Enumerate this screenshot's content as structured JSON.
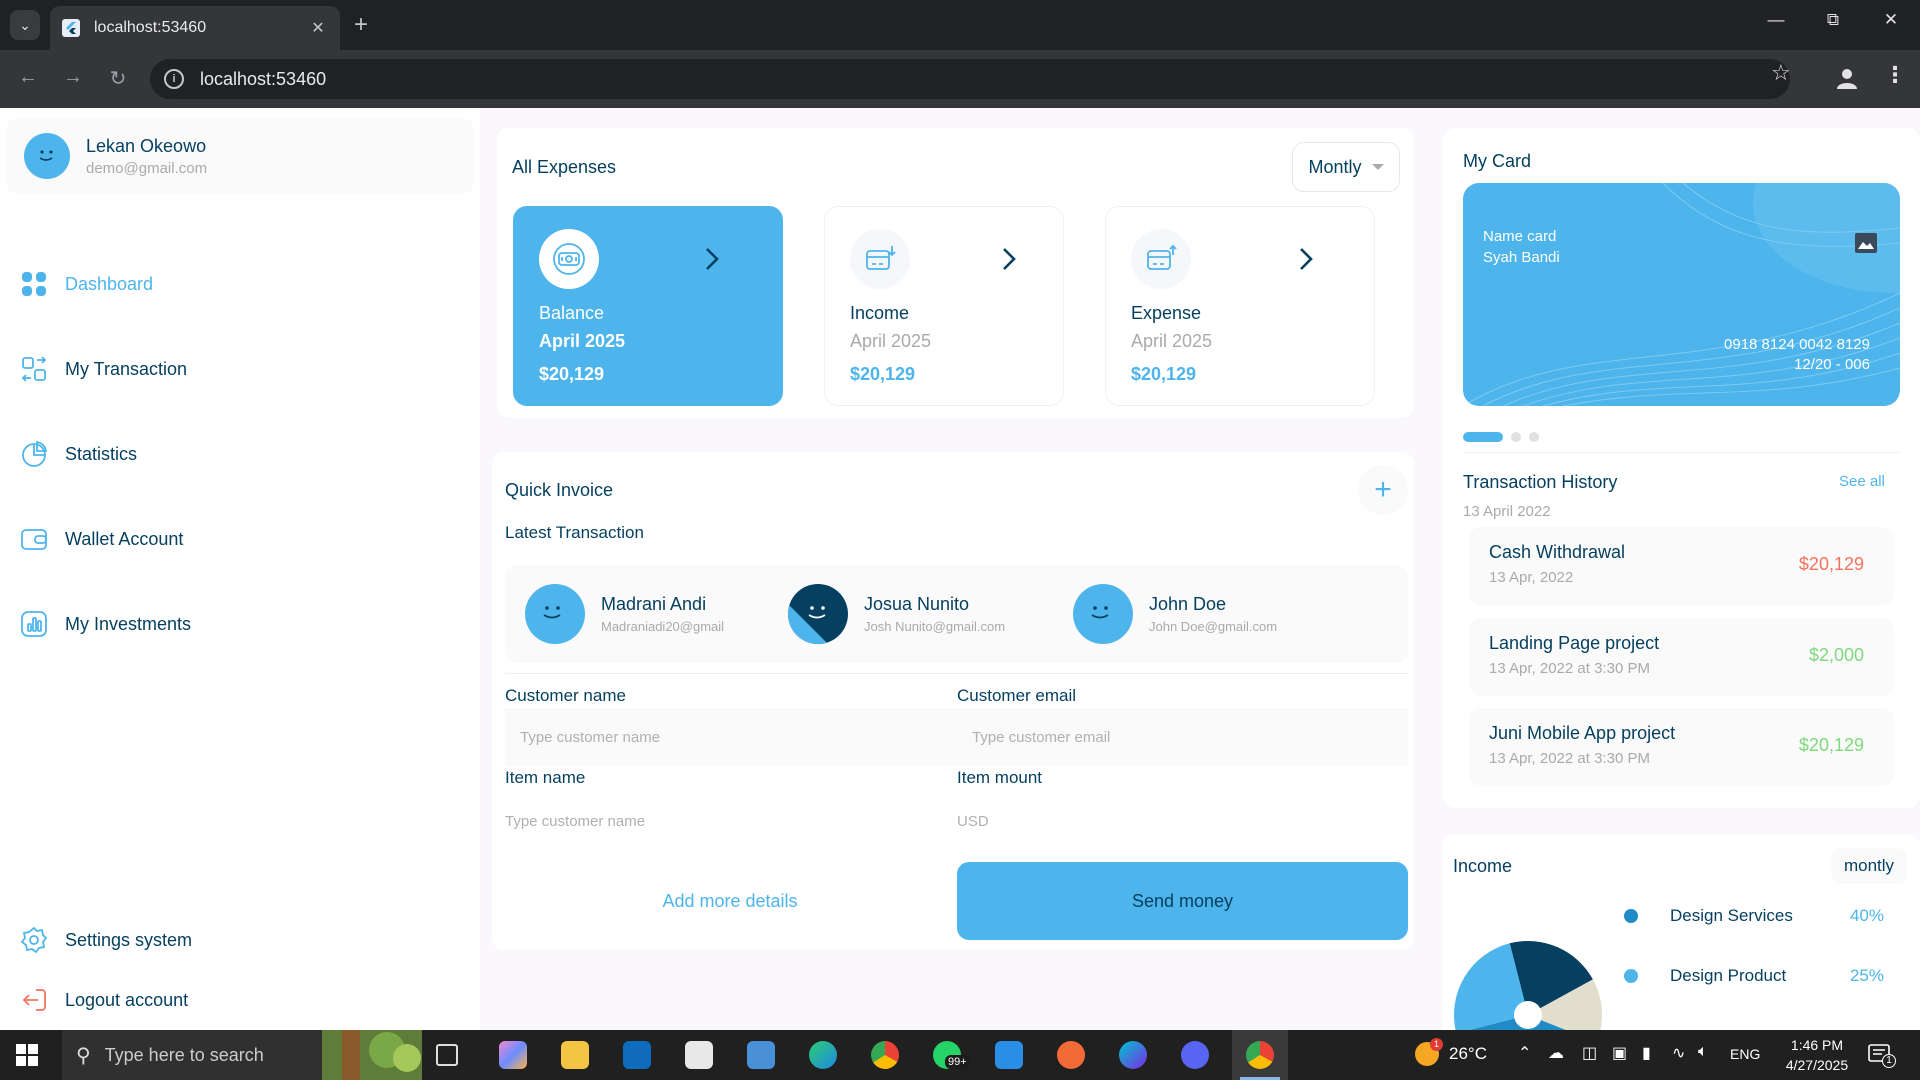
{
  "browser": {
    "tab_title": "localhost:53460",
    "url": "localhost:53460"
  },
  "user": {
    "name": "Lekan Okeowo",
    "email": "demo@gmail.com"
  },
  "sidebar": {
    "items": [
      {
        "label": "Dashboard",
        "icon": "dashboard-icon",
        "active": true
      },
      {
        "label": "My Transaction",
        "icon": "transaction-icon"
      },
      {
        "label": "Statistics",
        "icon": "statistics-icon"
      },
      {
        "label": "Wallet Account",
        "icon": "wallet-icon"
      },
      {
        "label": "My Investments",
        "icon": "investments-icon"
      }
    ],
    "bottom": [
      {
        "label": "Settings system",
        "icon": "settings-icon"
      },
      {
        "label": "Logout account",
        "icon": "logout-icon"
      }
    ]
  },
  "expenses": {
    "title": "All Expenses",
    "period": "Montly",
    "cards": [
      {
        "name": "Balance",
        "date": "April 2025",
        "amount": "$20,129",
        "active": true
      },
      {
        "name": "Income",
        "date": "April 2025",
        "amount": "$20,129"
      },
      {
        "name": "Expense",
        "date": "April 2025",
        "amount": "$20,129"
      }
    ]
  },
  "invoice": {
    "title": "Quick Invoice",
    "latest_label": "Latest Transaction",
    "people": [
      {
        "name": "Madrani Andi",
        "email": "Madraniadi20@gmail"
      },
      {
        "name": "Josua Nunito",
        "email": "Josh Nunito@gmail.com"
      },
      {
        "name": "John Doe",
        "email": "John Doe@gmail.com"
      }
    ],
    "customer_name_label": "Customer name",
    "customer_name_placeholder": "Type customer name",
    "customer_email_label": "Customer email",
    "customer_email_placeholder": "Type customer email",
    "item_name_label": "Item name",
    "item_name_placeholder": "Type customer name",
    "item_amount_label": "Item mount",
    "item_amount_placeholder": "USD",
    "add_more": "Add more details",
    "send": "Send money"
  },
  "my_card": {
    "title": "My Card",
    "label": "Name card",
    "holder": "Syah Bandi",
    "number": "0918 8124 0042 8129",
    "expiry": "12/20 - 006"
  },
  "history": {
    "title": "Transaction History",
    "see_all": "See all",
    "date": "13 April 2022",
    "items": [
      {
        "title": "Cash Withdrawal",
        "date": "13 Apr, 2022",
        "amount": "$20,129",
        "color": "#f3735e"
      },
      {
        "title": "Landing Page project",
        "date": "13 Apr, 2022 at 3:30 PM",
        "amount": "$2,000",
        "color": "#7dd97b"
      },
      {
        "title": "Juni Mobile App project",
        "date": "13 Apr, 2022 at 3:30 PM",
        "amount": "$20,129",
        "color": "#7dd97b"
      }
    ]
  },
  "income": {
    "title": "Income",
    "period": "montly",
    "legend": [
      {
        "name": "Design Services",
        "pct": "40%",
        "color": "#208bc7"
      },
      {
        "name": "Design Product",
        "pct": "25%",
        "color": "#4db5ec"
      }
    ]
  },
  "chart_data": {
    "type": "pie",
    "categories": [
      "Design Services",
      "Design Product"
    ],
    "values": [
      40,
      25
    ],
    "colors": [
      "#208bc7",
      "#4db5ec",
      "#064060",
      "#e2decd"
    ]
  },
  "taskbar": {
    "search_placeholder": "Type here to search",
    "weather": "26°C",
    "language": "ENG",
    "time": "1:46 PM",
    "date": "4/27/2025",
    "whatsapp_badge": "99+",
    "weather_badge": "1",
    "notification_count": "1"
  }
}
